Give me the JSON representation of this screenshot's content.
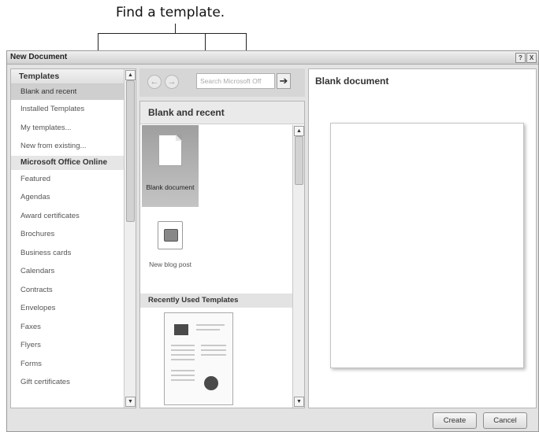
{
  "annotation": {
    "text": "Find a template."
  },
  "window": {
    "title": "New Document",
    "controls": [
      "?",
      "X"
    ]
  },
  "left_pane": {
    "header": "Templates",
    "items": [
      {
        "label": "Blank and recent",
        "selected": true
      },
      {
        "label": "Installed Templates"
      },
      {
        "label": "My templates..."
      },
      {
        "label": "New from existing..."
      }
    ],
    "section": "Microsoft Office Online",
    "online_items": [
      "Featured",
      "Agendas",
      "Award certificates",
      "Brochures",
      "Business cards",
      "Calendars",
      "Contracts",
      "Envelopes",
      "Faxes",
      "Flyers",
      "Forms",
      "Gift certificates"
    ]
  },
  "search": {
    "placeholder": "Search Microsoft Off"
  },
  "middle_pane": {
    "header": "Blank and recent",
    "tiles": [
      {
        "label": "Blank document",
        "selected": true,
        "icon": "blank-document-icon"
      },
      {
        "label": "New blog post",
        "icon": "blog-post-icon"
      }
    ],
    "recent_section": "Recently Used Templates"
  },
  "preview": {
    "title": "Blank document"
  },
  "buttons": {
    "create": "Create",
    "cancel": "Cancel"
  },
  "icons": {
    "back": "back-arrow-icon",
    "forward": "forward-arrow-icon",
    "go": "arrow-right-icon"
  }
}
